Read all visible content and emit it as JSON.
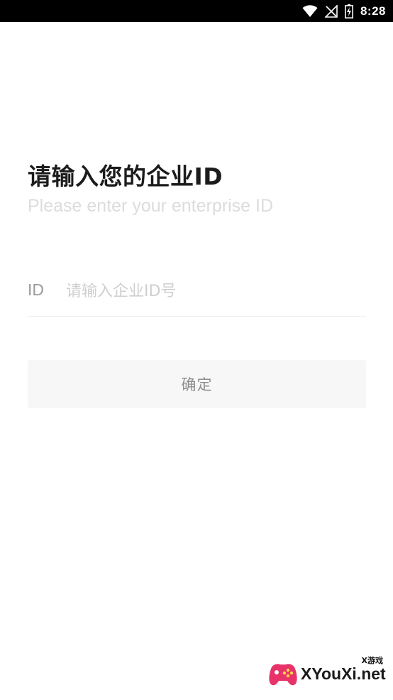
{
  "status_bar": {
    "time": "8:28",
    "icons": [
      "wifi-icon",
      "no-signal-icon",
      "battery-charging-icon"
    ]
  },
  "page": {
    "title": "请输入您的企业ID",
    "subtitle": "Please enter your enterprise ID"
  },
  "form": {
    "id_label": "ID",
    "id_placeholder": "请输入企业ID号",
    "id_value": "",
    "confirm_label": "确定"
  },
  "watermark": {
    "top_text": "X游戏",
    "brand_text": "XYouXi.net"
  },
  "colors": {
    "title": "#1c1c1c",
    "subtitle": "#dcdcdc",
    "button_bg": "#f7f7f7",
    "button_text": "#8e8e8e"
  }
}
